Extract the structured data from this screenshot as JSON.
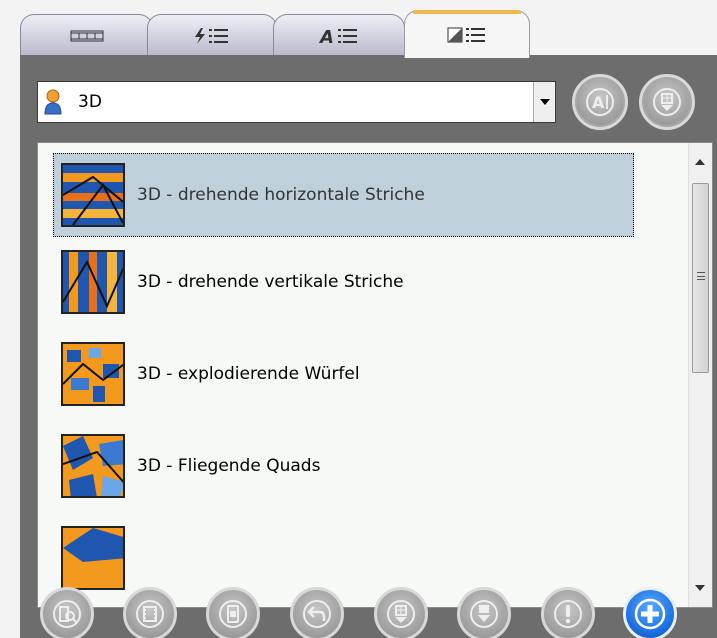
{
  "tabs": [
    {
      "icon": "film-strip-icon",
      "active": false
    },
    {
      "icon": "lightning-list-icon",
      "active": false
    },
    {
      "icon": "text-list-icon",
      "active": false
    },
    {
      "icon": "transition-list-icon",
      "active": true
    }
  ],
  "category": {
    "icon": "person-icon",
    "value": "3D"
  },
  "top_buttons": [
    "rename-icon",
    "move-down-icon"
  ],
  "list": {
    "items": [
      {
        "label": "3D - drehende horizontale Striche",
        "selected": true
      },
      {
        "label": "3D - drehende vertikale Striche",
        "selected": false
      },
      {
        "label": "3D - explodierende Würfel",
        "selected": false
      },
      {
        "label": "3D - Fliegende Quads",
        "selected": false
      },
      {
        "label": "",
        "selected": false
      }
    ]
  },
  "bottom_buttons": [
    "preview-icon",
    "film-icon",
    "phone-icon",
    "undo-icon",
    "move-down-icon",
    "insert-icon",
    "warning-icon",
    "add-icon"
  ],
  "colors": {
    "panel": "#6d6d6d",
    "selection": "#bfd0db",
    "active_tab_accent": "#f2b84a",
    "add_button": "#1c6fe0"
  }
}
